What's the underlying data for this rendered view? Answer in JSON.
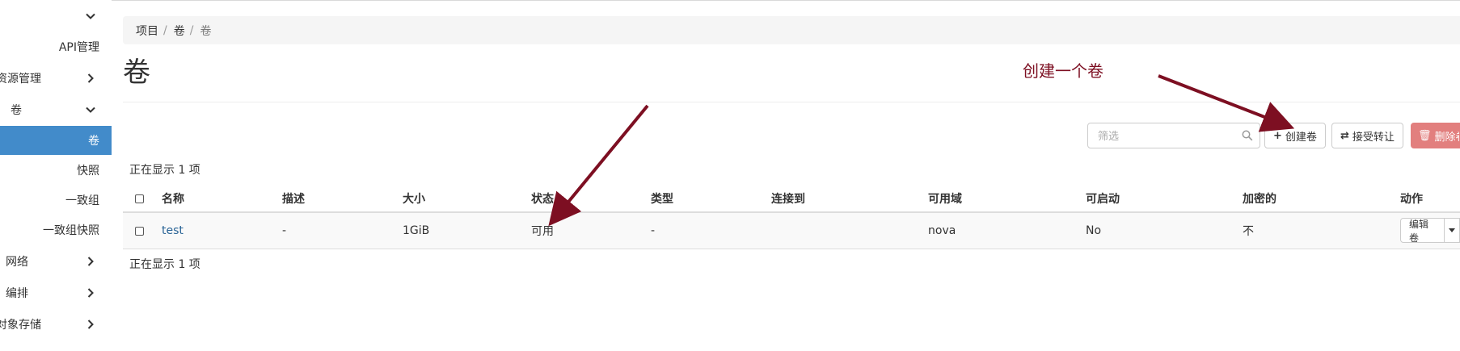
{
  "sidebar": {
    "items": [
      {
        "label": "",
        "expanded": true
      },
      {
        "label": "API管理"
      },
      {
        "label": "资源管理"
      },
      {
        "label": "卷",
        "expanded": true
      },
      {
        "label": "卷",
        "active": true
      },
      {
        "label": "快照"
      },
      {
        "label": "一致组"
      },
      {
        "label": "一致组快照"
      },
      {
        "label": "网络"
      },
      {
        "label": "编排"
      },
      {
        "label": "对象存储"
      }
    ]
  },
  "breadcrumb": [
    "项目",
    "卷",
    "卷"
  ],
  "page": {
    "title": "卷"
  },
  "toolbar": {
    "filter_placeholder": "筛选",
    "create_label": "创建卷",
    "accept_transfer_label": "接受转让",
    "delete_label": "删除卷"
  },
  "table": {
    "count_top": "正在显示 1 项",
    "count_bottom": "正在显示 1 项",
    "columns": [
      "名称",
      "描述",
      "大小",
      "状态",
      "类型",
      "连接到",
      "可用域",
      "可启动",
      "加密的",
      "动作"
    ],
    "rows": [
      {
        "name": "test",
        "description": "-",
        "size": "1GiB",
        "status": "可用",
        "type": "-",
        "attached_to": "",
        "zone": "nova",
        "bootable": "No",
        "encrypted": "不",
        "action": "编辑卷"
      }
    ]
  },
  "annotation": {
    "text": "创建一个卷",
    "color": "#7d0f22"
  },
  "colors": {
    "active": "#428bca",
    "link": "#2a6496",
    "danger": "#e27f7e"
  }
}
